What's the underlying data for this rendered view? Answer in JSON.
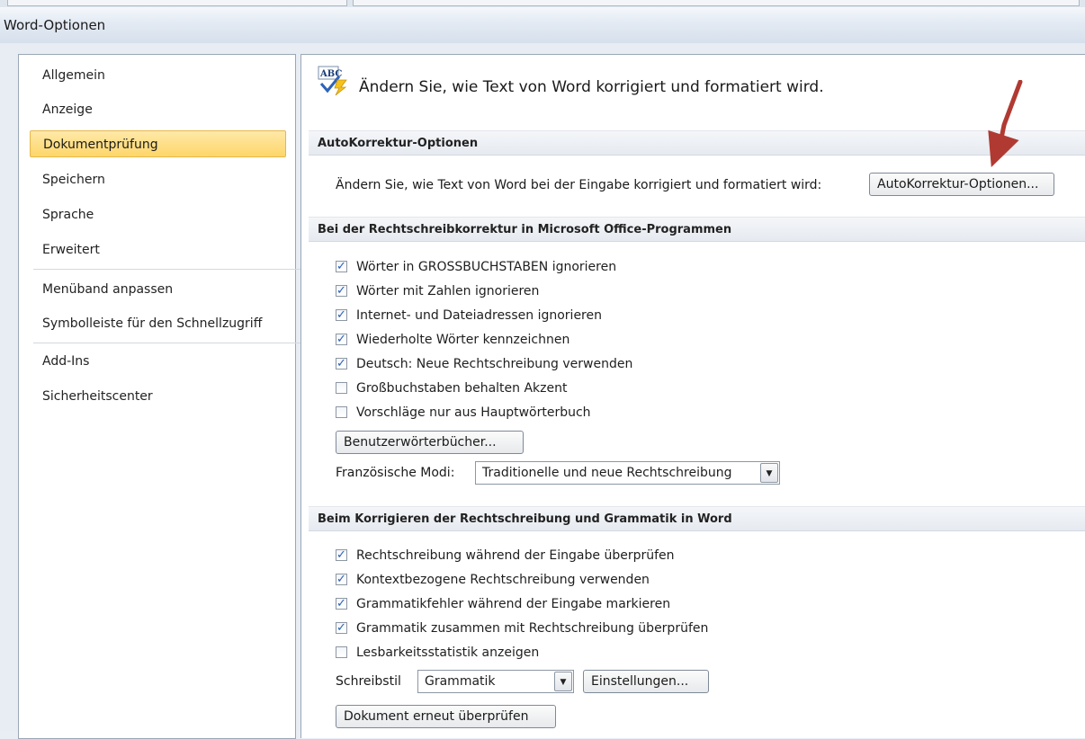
{
  "window": {
    "title": "Word-Optionen"
  },
  "nav": {
    "items": [
      {
        "label": "Allgemein"
      },
      {
        "label": "Anzeige"
      },
      {
        "label": "Dokumentprüfung"
      },
      {
        "label": "Speichern"
      },
      {
        "label": "Sprache"
      },
      {
        "label": "Erweitert"
      },
      {
        "label": "Menüband anpassen"
      },
      {
        "label": "Symbolleiste für den Schnellzugriff"
      },
      {
        "label": "Add-Ins"
      },
      {
        "label": "Sicherheitscenter"
      }
    ],
    "selected": "Dokumentprüfung"
  },
  "header": {
    "icon": "abc-spellcheck-icon",
    "text": "Ändern Sie, wie Text von Word korrigiert und formatiert wird."
  },
  "autocorrect": {
    "section": "AutoKorrektur-Optionen",
    "description": "Ändern Sie, wie Text von Word bei der Eingabe korrigiert und formatiert wird:",
    "button": "AutoKorrektur-Optionen..."
  },
  "office": {
    "section": "Bei der Rechtschreibkorrektur in Microsoft Office-Programmen",
    "checks": [
      {
        "label": "Wörter in GROSSBUCHSTABEN ignorieren",
        "checked": true
      },
      {
        "label": "Wörter mit Zahlen ignorieren",
        "checked": true
      },
      {
        "label": "Internet- und Dateiadressen ignorieren",
        "checked": true
      },
      {
        "label": "Wiederholte Wörter kennzeichnen",
        "checked": true
      },
      {
        "label": "Deutsch: Neue Rechtschreibung verwenden",
        "checked": true
      },
      {
        "label": "Großbuchstaben behalten Akzent",
        "checked": false
      },
      {
        "label": "Vorschläge nur aus Hauptwörterbuch",
        "checked": false
      }
    ],
    "dict_button": "Benutzerwörterbücher...",
    "french_label": "Französische Modi:",
    "french_value": "Traditionelle und neue Rechtschreibung"
  },
  "word": {
    "section": "Beim Korrigieren der Rechtschreibung und Grammatik in Word",
    "checks": [
      {
        "label": "Rechtschreibung während der Eingabe überprüfen",
        "checked": true
      },
      {
        "label": "Kontextbezogene Rechtschreibung verwenden",
        "checked": true
      },
      {
        "label": "Grammatikfehler während der Eingabe markieren",
        "checked": true
      },
      {
        "label": "Grammatik zusammen mit Rechtschreibung überprüfen",
        "checked": true
      },
      {
        "label": "Lesbarkeitsstatistik anzeigen",
        "checked": false
      }
    ],
    "style_label": "Schreibstil",
    "style_value": "Grammatik",
    "settings_button": "Einstellungen...",
    "recheck_button": "Dokument erneut überprüfen"
  },
  "colors": {
    "selected_nav": "#fdd66a",
    "annotation_arrow": "#b03a32",
    "check": "#2b5fb4"
  }
}
